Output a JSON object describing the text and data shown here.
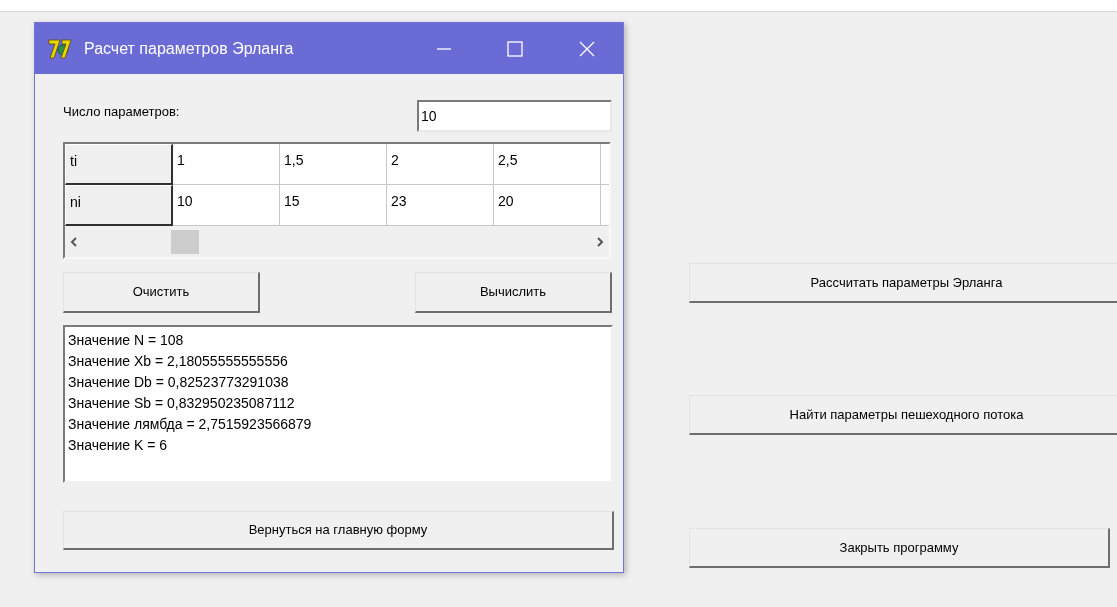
{
  "dialog": {
    "title": "Расчет параметров Эрланга",
    "param_label": "Число параметров:",
    "param_value": "10",
    "grid": {
      "rows": [
        {
          "header": "ti",
          "cells": [
            "1",
            "1,5",
            "2",
            "2,5"
          ]
        },
        {
          "header": "ni",
          "cells": [
            "10",
            "15",
            "23",
            "20"
          ]
        }
      ]
    },
    "buttons": [
      "Очистить",
      "Вычислить"
    ],
    "output_lines": [
      "Значение N = 108",
      "Значение Xb = 2,18055555555556",
      "Значение Db = 0,82523773291038",
      "Значение Sb = 0,832950235087112",
      "Значение лямбда = 2,7515923566879",
      "Значение K = 6"
    ],
    "back_button": "Вернуться на главную форму"
  },
  "main_buttons": [
    "Рассчитать параметры Эрланга",
    "Найти параметры пешеходного потока",
    "Закрыть программу"
  ]
}
